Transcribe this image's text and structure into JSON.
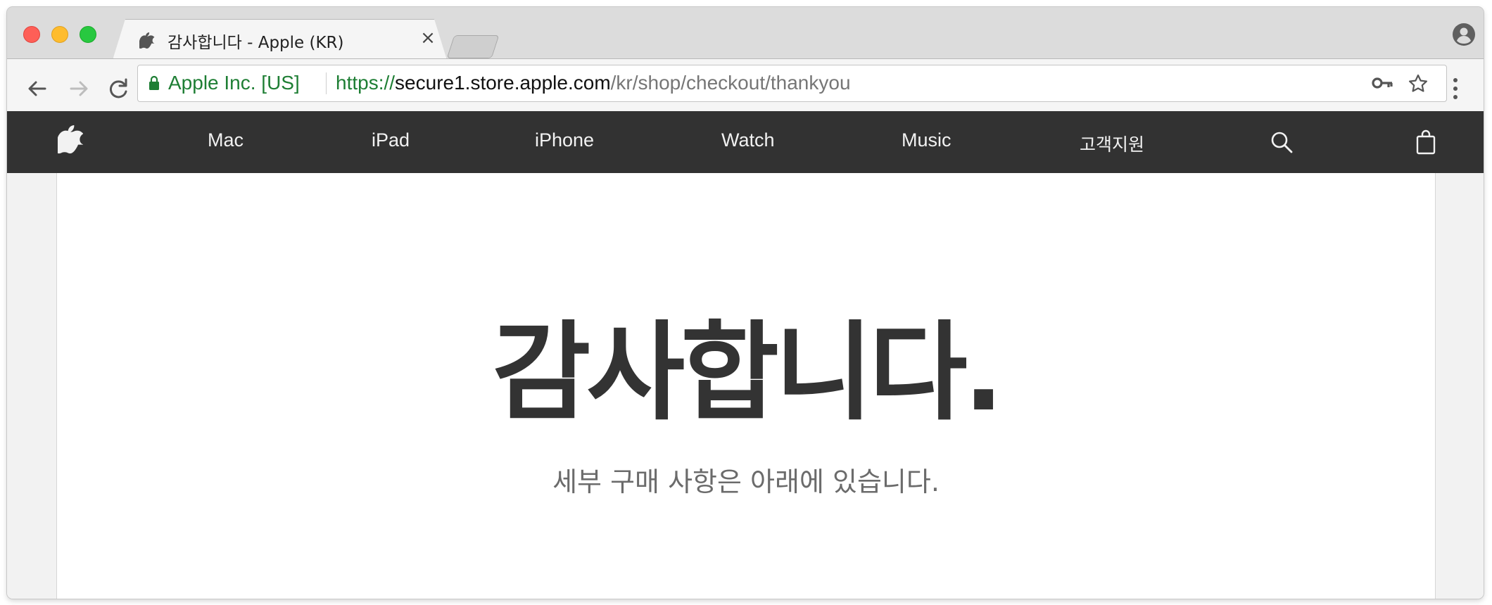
{
  "tab": {
    "title": "감사합니다 - Apple (KR)",
    "close_glyph": "×"
  },
  "omnibox": {
    "secure_org": "Apple Inc. [US]",
    "url_scheme": "https://",
    "url_host": "secure1.store.apple.com",
    "url_path": "/kr/shop/checkout/thankyou"
  },
  "nav": {
    "items": [
      "Mac",
      "iPad",
      "iPhone",
      "Watch",
      "Music",
      "고객지원"
    ]
  },
  "main": {
    "heading": "감사합니다.",
    "subheading": "세부 구매 사항은 아래에 있습니다."
  },
  "colors": {
    "nav_background": "#323232",
    "secure_green": "#1e7e34",
    "heading_text": "#333333"
  },
  "icons": {
    "tab_favicon": "apple-logo-icon",
    "back": "arrow-left-icon",
    "forward": "arrow-right-icon",
    "reload": "reload-icon",
    "lock": "lock-icon",
    "key": "key-icon",
    "bookmark": "star-icon",
    "menu": "kebab-menu-icon",
    "profile": "profile-icon",
    "nav_logo": "apple-logo-icon",
    "search": "search-icon",
    "bag": "shopping-bag-icon"
  }
}
